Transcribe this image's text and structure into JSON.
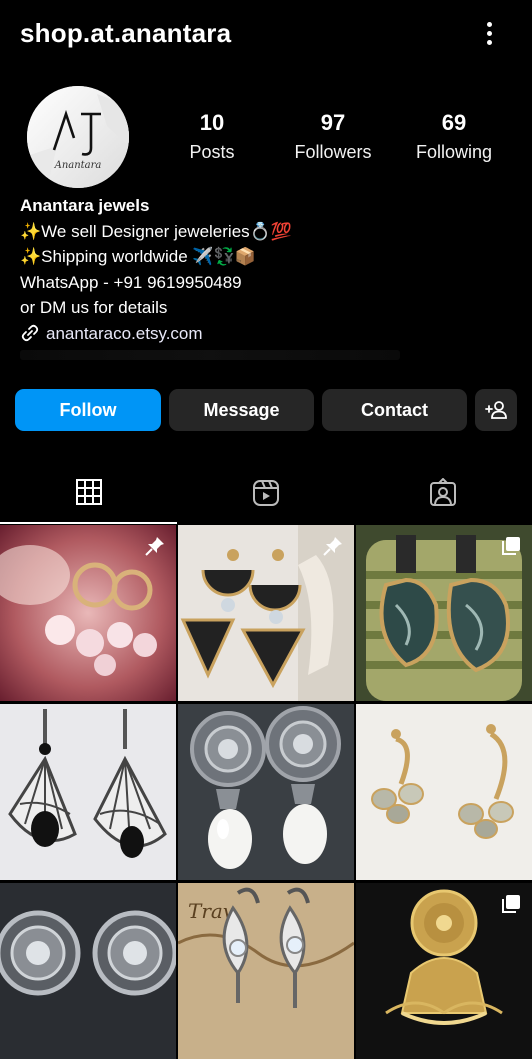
{
  "profile": {
    "username": "shop.at.anantara",
    "avatar_monogram": "AJ",
    "avatar_caption": "Anantara",
    "stats": [
      {
        "value": "10",
        "label": "Posts"
      },
      {
        "value": "97",
        "label": "Followers"
      },
      {
        "value": "69",
        "label": "Following"
      }
    ],
    "bio": {
      "name": "Anantara jewels",
      "lines": [
        "✨We sell Designer jeweleries💍💯",
        "✨Shipping worldwide ✈️💱📦",
        "WhatsApp - +91 9619950489",
        "or DM us for details"
      ],
      "link": "anantaraco.etsy.com"
    }
  },
  "actions": {
    "follow": "Follow",
    "message": "Message",
    "contact": "Contact"
  },
  "tabs": [
    "grid-icon",
    "reels-icon",
    "tagged-icon"
  ],
  "colors": {
    "accent": "#0095f6",
    "button_dark": "#262626",
    "background": "#000000"
  },
  "grid_posts": [
    {
      "name": "pink-stone-earrings",
      "badge": "pin-icon"
    },
    {
      "name": "black-triangle-earrings",
      "badge": "pin-icon"
    },
    {
      "name": "green-stone-earrings",
      "badge": "carousel-icon"
    },
    {
      "name": "silver-web-earrings",
      "badge": ""
    },
    {
      "name": "pearl-drop-earrings",
      "badge": ""
    },
    {
      "name": "gold-stone-earrings",
      "badge": ""
    },
    {
      "name": "silver-stud-earrings",
      "badge": ""
    },
    {
      "name": "crystal-hoop-earrings",
      "badge": ""
    },
    {
      "name": "gold-jhumka-earrings",
      "badge": "carousel-icon"
    }
  ]
}
